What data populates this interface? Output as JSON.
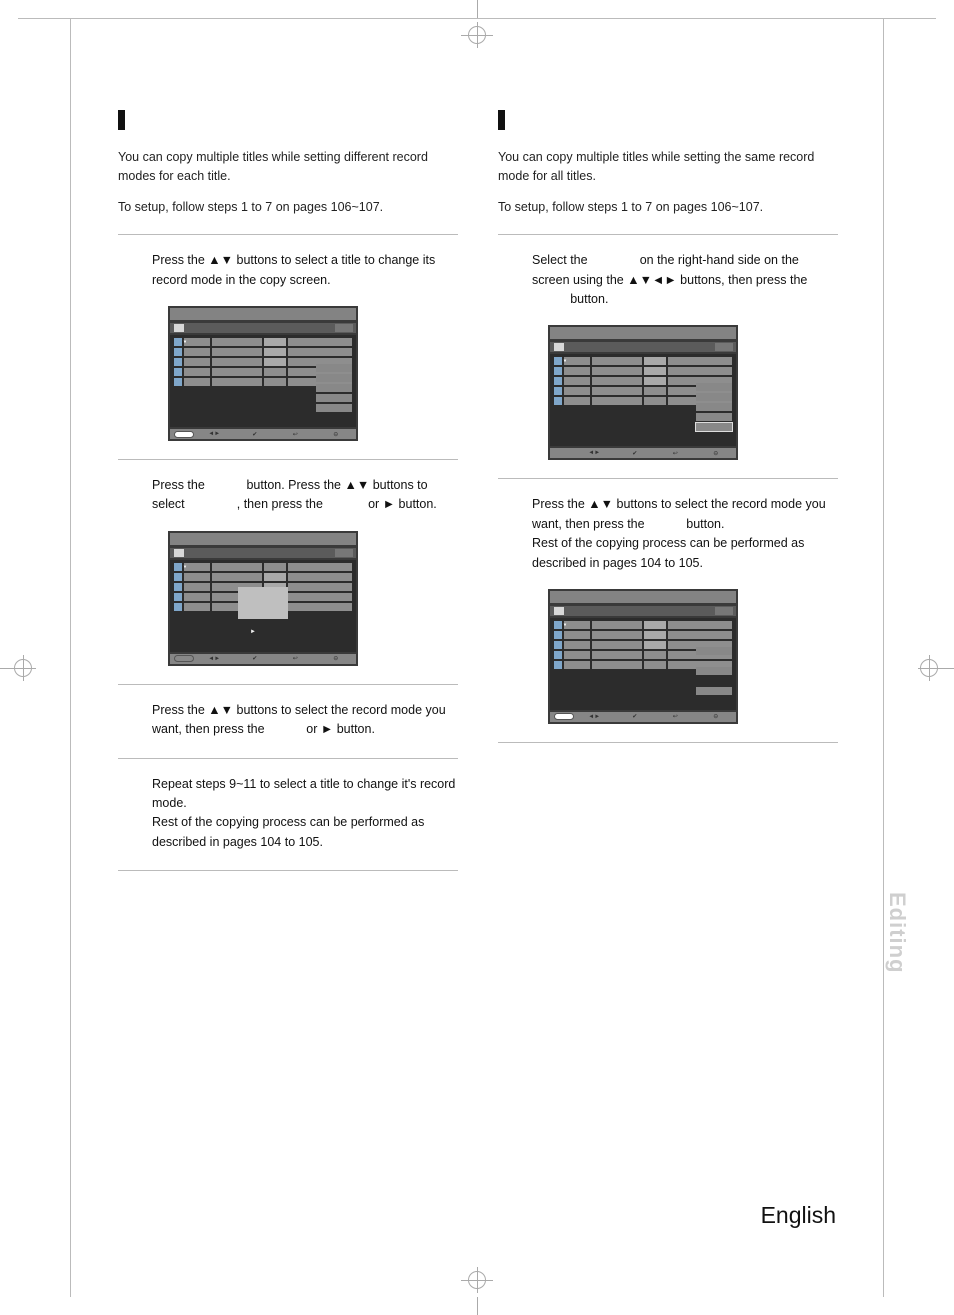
{
  "left": {
    "intro1": "You can copy multiple titles while setting different record modes for each title.",
    "intro2": "To setup, follow steps 1 to 7 on pages 106~107.",
    "step9": {
      "pre": "Press the ",
      "arrows": "▲▼",
      "post": " buttons to select a title to change its record mode in the copy screen."
    },
    "step10": {
      "pre": "Press the ",
      "btn1": "button. Press the ",
      "arrows": "▲▼",
      "mid": " buttons to select ",
      "mid2": ", then press the ",
      "or": "or ",
      "rarrow": "►",
      "end": " button."
    },
    "step11": {
      "pre": "Press the ",
      "arrows": "▲▼",
      "mid": " buttons to select the record mode you want, then press the ",
      "or": "or ",
      "rarrow": "►",
      "end": " button."
    },
    "step12": {
      "l1": "Repeat steps 9~11 to select a title to change it's record mode.",
      "l2": "Rest of the copying process can be performed as described in pages 104 to 105."
    }
  },
  "right": {
    "intro1": "You can copy multiple titles while setting the same record mode for all titles.",
    "intro2": "To setup, follow steps 1 to 7 on pages 106~107.",
    "step9": {
      "pre": "Select the ",
      "mid": "on the right-hand side on the screen using the ",
      "arrows": "▲▼◄►",
      "mid2": " buttons, then press the ",
      "end": "button."
    },
    "step10": {
      "pre": "Press the ",
      "arrows": "▲▼",
      "mid": " buttons to select the record mode you want, then press the ",
      "end": "button.",
      "l2": "Rest of the copying process can be performed as described in pages 104 to 105."
    }
  },
  "footer": {
    "lang": "English",
    "sidelabel": "Editing"
  }
}
